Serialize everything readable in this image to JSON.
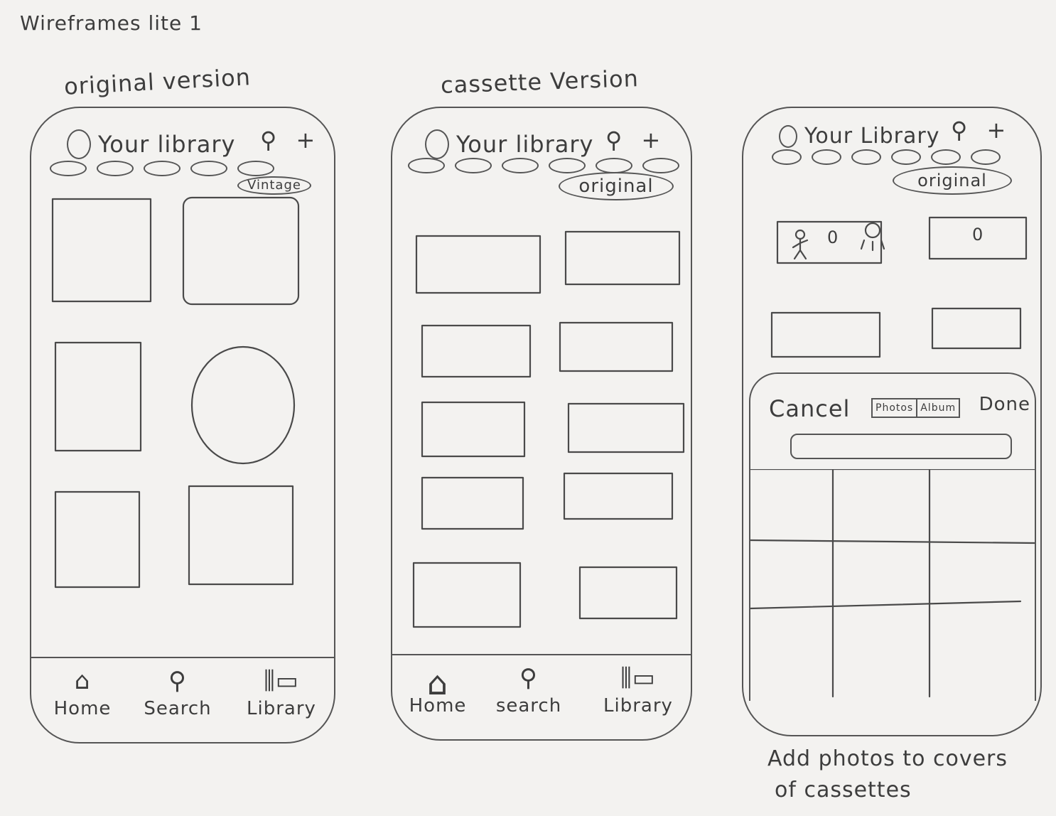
{
  "title": "Wireframes lite 1",
  "captions": [
    "original version",
    "cassette Version"
  ],
  "phones": [
    {
      "header": "Your library",
      "icons": [
        "circle-icon",
        "search-icon",
        "plus-icon"
      ],
      "toggle": "Vintage",
      "nav": [
        {
          "icon": "home-icon",
          "label": "Home"
        },
        {
          "icon": "search-icon",
          "label": "Search"
        },
        {
          "icon": "library-icon",
          "label": "Library"
        }
      ]
    },
    {
      "header": "Your library",
      "icons": [
        "circle-icon",
        "search-icon",
        "plus-icon"
      ],
      "toggle": "original",
      "nav": [
        {
          "icon": "home-icon",
          "label": "Home"
        },
        {
          "icon": "search-icon",
          "label": "search"
        },
        {
          "icon": "library-icon",
          "label": "Library"
        }
      ]
    },
    {
      "header": "Your Library",
      "icons": [
        "circle-icon",
        "search-icon",
        "plus-icon"
      ],
      "toggle": "original",
      "sheet": {
        "cancel": "Cancel",
        "segments": [
          "Photos",
          "Album"
        ],
        "done": "Done"
      }
    }
  ],
  "glyphs": {
    "circle_in_cassette": "0",
    "search": "⚲",
    "plus": "+",
    "home": "⌂",
    "library": "⫼▭"
  },
  "note": [
    "Add photos to covers",
    "of cassettes"
  ]
}
